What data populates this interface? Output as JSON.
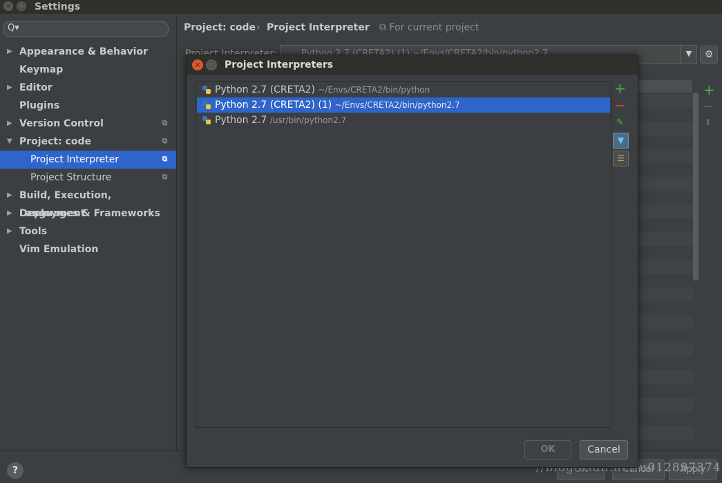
{
  "window": {
    "title": "Settings",
    "close_glyph": "×",
    "max_glyph": "□"
  },
  "search": {
    "icon": "search-icon",
    "glyph": "Q▾",
    "value": ""
  },
  "sidebar": {
    "items": [
      {
        "label": "Appearance & Behavior",
        "arrow": "▶",
        "copy": ""
      },
      {
        "label": "Keymap",
        "arrow": "",
        "copy": ""
      },
      {
        "label": "Editor",
        "arrow": "▶",
        "copy": ""
      },
      {
        "label": "Plugins",
        "arrow": "",
        "copy": ""
      },
      {
        "label": "Version Control",
        "arrow": "▶",
        "copy": "⧉"
      },
      {
        "label": "Project: code",
        "arrow": "▼",
        "copy": "⧉"
      },
      {
        "label": "Project Interpreter",
        "arrow": "",
        "copy": "⧉"
      },
      {
        "label": "Project Structure",
        "arrow": "",
        "copy": "⧉"
      },
      {
        "label": "Build, Execution, Deployment",
        "arrow": "▶",
        "copy": ""
      },
      {
        "label": "Languages & Frameworks",
        "arrow": "▶",
        "copy": ""
      },
      {
        "label": "Tools",
        "arrow": "▶",
        "copy": ""
      },
      {
        "label": "Vim Emulation",
        "arrow": "",
        "copy": ""
      }
    ]
  },
  "breadcrumb": {
    "part1": "Project: code",
    "separator": "›",
    "part2": "Project Interpreter",
    "note": "⧉ For current project"
  },
  "interpreter": {
    "label": "Project Interpreter:",
    "selected": "Python 2.7 (CRETA2) (1)  ~/Envs/CRETA2/bin/python2.7",
    "dropdown_glyph": "▼",
    "gear_glyph": "⚙"
  },
  "packages_toolbar": {
    "add": "+",
    "remove": "−",
    "up": "⬆"
  },
  "dialog": {
    "title": "Project Interpreters",
    "close_glyph": "×",
    "max_glyph": "□",
    "interpreters": [
      {
        "name": "Python 2.7 (CRETA2)",
        "path": "~/Envs/CRETA2/bin/python",
        "selected": false
      },
      {
        "name": "Python 2.7 (CRETA2) (1)",
        "path": "~/Envs/CRETA2/bin/python2.7",
        "selected": true
      },
      {
        "name": "Python 2.7",
        "path": "/usr/bin/python2.7",
        "selected": false
      }
    ],
    "toolbar": {
      "add": "+",
      "remove": "−",
      "edit": "✎",
      "filter": "▼",
      "tree": "☰"
    },
    "ok_label": "OK",
    "cancel_label": "Cancel"
  },
  "footer": {
    "help_glyph": "?",
    "ok_label": "OK",
    "cancel_label": "Cancel",
    "apply_label": "Apply",
    "watermark": "//blog.csdn.net/u012897374"
  },
  "colors": {
    "accent_selection": "#2f65ca",
    "add_green": "#49b546",
    "remove_red": "#d9453a",
    "close_orange": "#e2572d"
  }
}
